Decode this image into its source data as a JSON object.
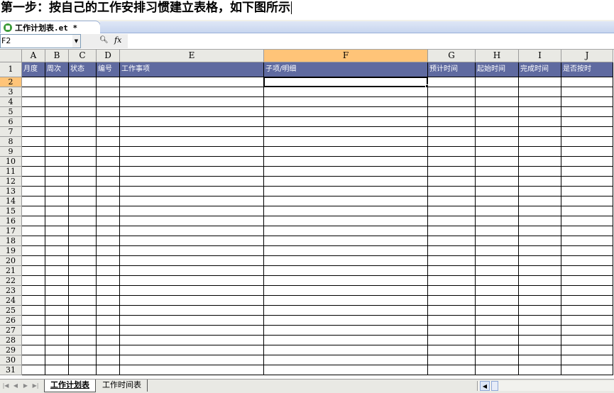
{
  "instruction": "第一步：按自己的工作安排习惯建立表格，如下图所示",
  "document_tab": {
    "title": "工作计划表.et *"
  },
  "formula_bar": {
    "name_box": "F2",
    "formula": ""
  },
  "columns": [
    {
      "letter": "A",
      "header": "月度"
    },
    {
      "letter": "B",
      "header": "周次"
    },
    {
      "letter": "C",
      "header": "状态"
    },
    {
      "letter": "D",
      "header": "编号"
    },
    {
      "letter": "E",
      "header": "工作事项"
    },
    {
      "letter": "F",
      "header": "子项/明细"
    },
    {
      "letter": "G",
      "header": "预计时间"
    },
    {
      "letter": "H",
      "header": "起始时间"
    },
    {
      "letter": "I",
      "header": "完成时间"
    },
    {
      "letter": "J",
      "header": "是否按时"
    }
  ],
  "rows": [
    "1",
    "2",
    "3",
    "4",
    "5",
    "6",
    "7",
    "8",
    "9",
    "10",
    "11",
    "12",
    "13",
    "14",
    "15",
    "16",
    "17",
    "18",
    "19",
    "20",
    "21",
    "22",
    "23",
    "24",
    "25",
    "26",
    "27",
    "28",
    "29",
    "30",
    "31"
  ],
  "active_cell": {
    "column": "F",
    "row": "2"
  },
  "sheets": [
    {
      "name": "工作计划表",
      "active": true
    },
    {
      "name": "工作时间表",
      "active": false
    }
  ],
  "colors": {
    "header_fill": "#5f6aa0",
    "active_header": "#ffc478"
  }
}
